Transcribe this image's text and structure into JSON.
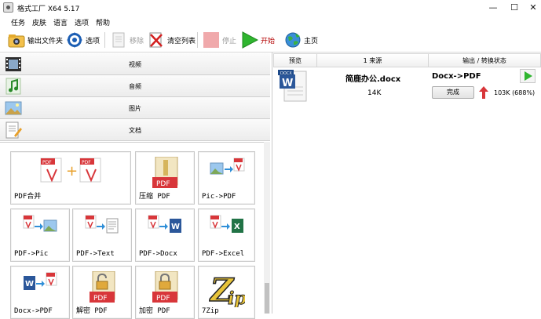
{
  "window": {
    "title": "格式工厂 X64 5.17",
    "controls": {
      "minimize": "—",
      "maximize": "☐",
      "close": "✕"
    }
  },
  "menu": [
    "任务",
    "皮肤",
    "语言",
    "选项",
    "帮助"
  ],
  "toolbar": {
    "output_folder": "输出文件夹",
    "options": "选项",
    "remove": "移除",
    "clear_list": "清空列表",
    "stop": "停止",
    "start": "开始",
    "home": "主页"
  },
  "categories": [
    {
      "label": "视频",
      "icon": "film-icon"
    },
    {
      "label": "音频",
      "icon": "music-note-icon"
    },
    {
      "label": "图片",
      "icon": "picture-icon"
    },
    {
      "label": "文档",
      "icon": "document-icon"
    }
  ],
  "tiles": [
    {
      "label": "PDF合并"
    },
    {
      "label": "压缩 PDF"
    },
    {
      "label": "Pic->PDF"
    },
    {
      "label": "PDF->Pic"
    },
    {
      "label": "PDF->Text"
    },
    {
      "label": "PDF->Docx"
    },
    {
      "label": "PDF->Excel"
    },
    {
      "label": "Docx->PDF"
    },
    {
      "label": "解密 PDF"
    },
    {
      "label": "加密 PDF"
    },
    {
      "label": "7Zip"
    }
  ],
  "task_list": {
    "columns": [
      "预览",
      "1 来源",
      "输出 / 转换状态"
    ],
    "rows": [
      {
        "source_name": "简鹿办公.docx",
        "source_size": "14K",
        "conversion": "Docx->PDF",
        "status_button": "完成",
        "output_size": "103K",
        "ratio": "(688%)"
      }
    ]
  },
  "colors": {
    "pdf_red": "#d8363a",
    "start_green": "#2fb52f",
    "accent_red": "#b30000"
  }
}
